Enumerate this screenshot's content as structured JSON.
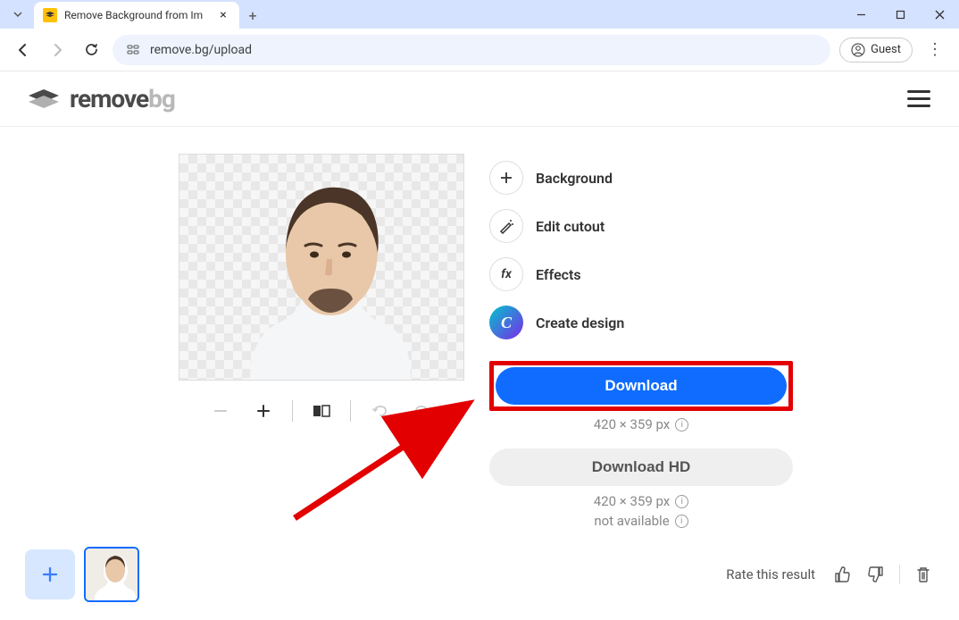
{
  "browser": {
    "tab_title": "Remove Background from Im",
    "url": "remove.bg/upload",
    "guest_label": "Guest"
  },
  "header": {
    "logo_bold": "remove",
    "logo_light": "bg"
  },
  "actions": {
    "background": "Background",
    "edit_cutout": "Edit cutout",
    "effects": "Effects",
    "create_design": "Create design"
  },
  "downloads": {
    "primary_label": "Download",
    "primary_dimensions": "420 × 359 px",
    "hd_label": "Download HD",
    "hd_dimensions": "420 × 359 px",
    "hd_status": "not available"
  },
  "footer": {
    "rate_label": "Rate this result"
  }
}
